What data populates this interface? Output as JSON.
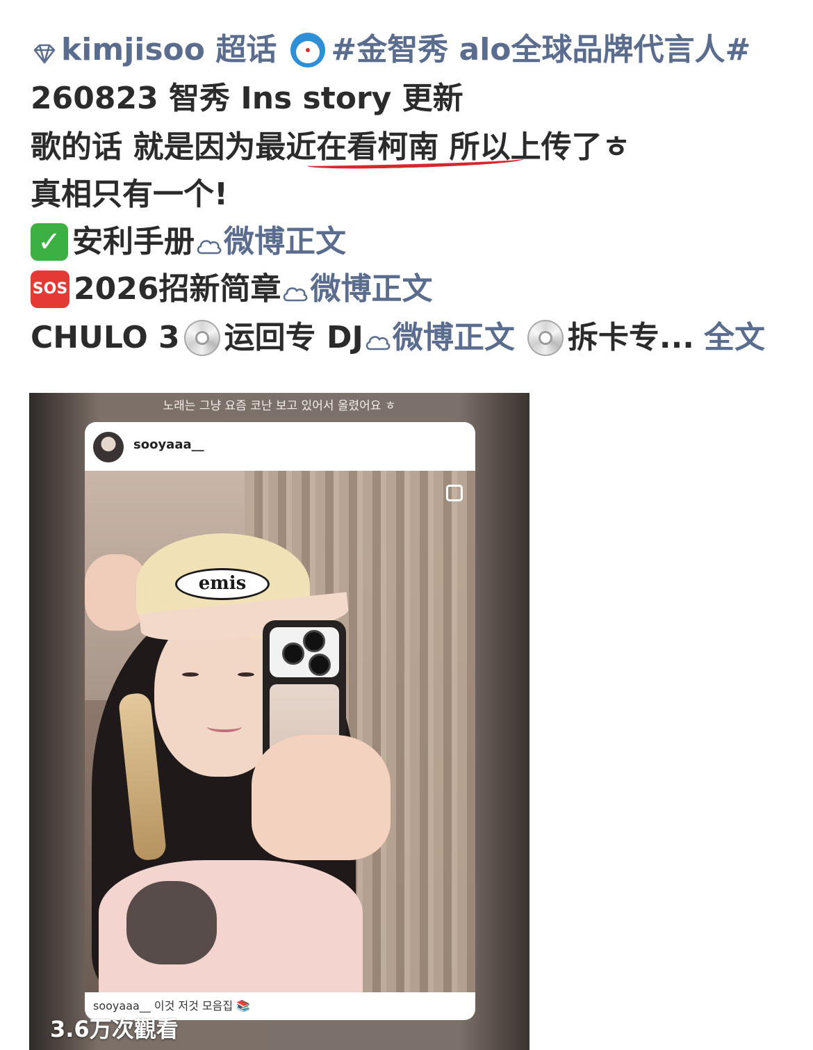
{
  "post": {
    "supertopic": "kimjisoo 超话",
    "hashtag": "#金智秀 alo全球品牌代言人#",
    "date_line": "260823 智秀 Ins story 更新",
    "quote_line": "歌的话 就是因为最近在看柯南 所以上传了ㅎ",
    "tagline": "真相只有一个!",
    "link_rows": [
      {
        "label": "安利手册",
        "link": "微博正文"
      },
      {
        "label": "2026招新简章",
        "link": "微博正文"
      }
    ],
    "last_row": {
      "prefix": "CHULO 3",
      "middle": "运回专 DJ",
      "link": "微博正文",
      "tail": "拆卡专...",
      "full_text": "全文"
    },
    "emoji": {
      "check": "✓",
      "sos": "SOS"
    }
  },
  "media": {
    "story_caption": "노래는 그냥 요즘 코난 보고 있어서 올렸어요 ㅎ",
    "username": "sooyaaa__",
    "cap_logo": "emis",
    "footer_text": "sooyaaa__ 이것 저것 모음집 📚",
    "views": "3.6万次觀看"
  },
  "colors": {
    "link": "#5b6d8e",
    "text": "#2b2b2b",
    "underline": "#d8262c"
  }
}
